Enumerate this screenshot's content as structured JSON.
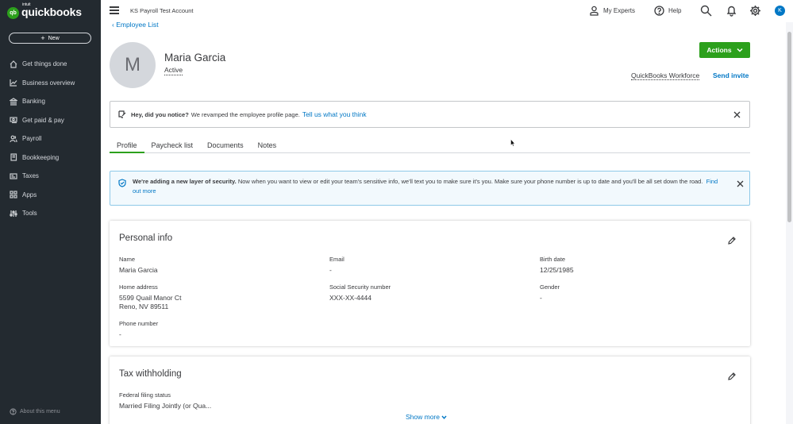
{
  "brand": {
    "intuit": "intuit",
    "wordmark": "quickbooks",
    "logo_mark": "qb"
  },
  "sidebar": {
    "new_label": "New",
    "items": [
      {
        "label": "Get things done",
        "icon": "home-icon"
      },
      {
        "label": "Business overview",
        "icon": "chart-icon"
      },
      {
        "label": "Banking",
        "icon": "bank-icon"
      },
      {
        "label": "Get paid & pay",
        "icon": "cash-icon"
      },
      {
        "label": "Payroll",
        "icon": "people-icon"
      },
      {
        "label": "Bookkeeping",
        "icon": "book-icon"
      },
      {
        "label": "Taxes",
        "icon": "tax-icon"
      },
      {
        "label": "Apps",
        "icon": "apps-icon"
      },
      {
        "label": "Tools",
        "icon": "tools-icon"
      }
    ],
    "about": "About this menu"
  },
  "topbar": {
    "account": "KS Payroll Test Account",
    "my_experts": "My Experts",
    "help": "Help",
    "avatar_initial": "K"
  },
  "employee": {
    "back_link": "Employee List",
    "initial": "M",
    "name": "Maria Garcia",
    "status": "Active",
    "actions_label": "Actions",
    "workforce_label": "QuickBooks Workforce",
    "send_invite": "Send invite"
  },
  "notice": {
    "bold": "Hey, did you notice?",
    "text": "We revamped the employee profile page.",
    "link": "Tell us what you think"
  },
  "tabs": [
    "Profile",
    "Paycheck list",
    "Documents",
    "Notes"
  ],
  "security_notice": {
    "bold": "We're adding a new layer of security.",
    "text": "Now when you want to view or edit your team's sensitive info, we'll text you to make sure it's you. Make sure your phone number is up to date and you'll be all set down the road.",
    "link": "Find out more"
  },
  "personal_info": {
    "title": "Personal info",
    "name_label": "Name",
    "name_value": "Maria Garcia",
    "email_label": "Email",
    "email_value": "-",
    "birth_label": "Birth date",
    "birth_value": "12/25/1985",
    "address_label": "Home address",
    "address_line1": "5599 Quail Manor Ct",
    "address_line2": "Reno, NV 89511",
    "ssn_label": "Social Security number",
    "ssn_value": "XXX-XX-4444",
    "gender_label": "Gender",
    "gender_value": "-",
    "phone_label": "Phone number",
    "phone_value": "-"
  },
  "tax_withholding": {
    "title": "Tax withholding",
    "filing_label": "Federal filing status",
    "filing_value": "Married Filing Jointly (or Qua...",
    "show_more": "Show more"
  },
  "colors": {
    "sidebar_bg": "#232a30",
    "accent_green": "#2ca01c",
    "link_blue": "#0077c5"
  }
}
